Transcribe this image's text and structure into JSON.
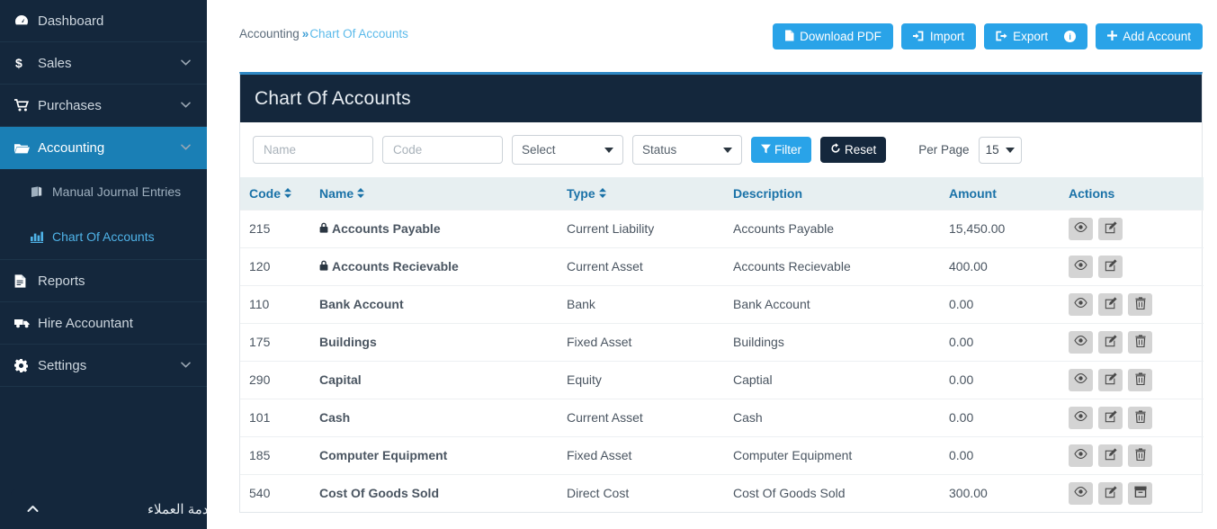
{
  "sidebar": {
    "items": [
      {
        "label": "Dashboard",
        "icon": "dashboard-icon",
        "glyph": "⚙",
        "caret": false,
        "active": false
      },
      {
        "label": "Sales",
        "icon": "dollar-icon",
        "glyph": "$",
        "caret": true,
        "active": false
      },
      {
        "label": "Purchases",
        "icon": "cart-icon",
        "glyph": "🛒",
        "caret": true,
        "active": false
      },
      {
        "label": "Accounting",
        "icon": "folder-open-icon",
        "glyph": "🗁",
        "caret": true,
        "active": true
      }
    ],
    "sub_items": [
      {
        "label": "Manual Journal Entries",
        "icon": "book-icon",
        "glyph": "📕",
        "selected": false
      },
      {
        "label": "Chart Of Accounts",
        "icon": "bar-chart-icon",
        "glyph": "📊",
        "selected": true
      }
    ],
    "items_after": [
      {
        "label": "Reports",
        "icon": "file-text-icon",
        "glyph": "📄",
        "caret": false,
        "active": false
      },
      {
        "label": "Hire Accountant",
        "icon": "truck-icon",
        "glyph": "🚚",
        "caret": false,
        "active": false
      },
      {
        "label": "Settings",
        "icon": "gear-icon",
        "glyph": "⚙",
        "caret": true,
        "active": false
      }
    ],
    "customer_service": {
      "label": "خدمة العملاء",
      "chevron": "⌃"
    }
  },
  "breadcrumb": {
    "root": "Accounting",
    "separator": "»",
    "current": "Chart Of Accounts"
  },
  "toolbar": {
    "download_pdf": "Download PDF",
    "import": "Import",
    "export": "Export",
    "add_account": "Add Account",
    "info_badge": "i"
  },
  "panel": {
    "title": "Chart Of Accounts"
  },
  "filters": {
    "name_placeholder": "Name",
    "name_value": "",
    "code_placeholder": "Code",
    "code_value": "",
    "type_select": "Select",
    "status_select": "Status",
    "filter_button": "Filter",
    "reset_button": "Reset",
    "per_page_label": "Per Page",
    "per_page_value": "15"
  },
  "table": {
    "columns": [
      {
        "label": "Code",
        "sortable": true
      },
      {
        "label": "Name",
        "sortable": true
      },
      {
        "label": "Type",
        "sortable": true
      },
      {
        "label": "Description",
        "sortable": false
      },
      {
        "label": "Amount",
        "sortable": false
      },
      {
        "label": "Actions",
        "sortable": false
      }
    ],
    "rows": [
      {
        "code": "215",
        "name": "Accounts Payable",
        "locked": true,
        "type": "Current Liability",
        "description": "Accounts Payable",
        "amount": "15,450.00",
        "actions": [
          "view",
          "edit"
        ]
      },
      {
        "code": "120",
        "name": "Accounts Recievable",
        "locked": true,
        "type": "Current Asset",
        "description": "Accounts Recievable",
        "amount": "400.00",
        "actions": [
          "view",
          "edit"
        ]
      },
      {
        "code": "110",
        "name": "Bank Account",
        "locked": false,
        "type": "Bank",
        "description": "Bank Account",
        "amount": "0.00",
        "actions": [
          "view",
          "edit",
          "delete"
        ]
      },
      {
        "code": "175",
        "name": "Buildings",
        "locked": false,
        "type": "Fixed Asset",
        "description": "Buildings",
        "amount": "0.00",
        "actions": [
          "view",
          "edit",
          "delete"
        ]
      },
      {
        "code": "290",
        "name": "Capital",
        "locked": false,
        "type": "Equity",
        "description": "Captial",
        "amount": "0.00",
        "actions": [
          "view",
          "edit",
          "delete"
        ]
      },
      {
        "code": "101",
        "name": "Cash",
        "locked": false,
        "type": "Current Asset",
        "description": "Cash",
        "amount": "0.00",
        "actions": [
          "view",
          "edit",
          "delete"
        ]
      },
      {
        "code": "185",
        "name": "Computer Equipment",
        "locked": false,
        "type": "Fixed Asset",
        "description": "Computer Equipment",
        "amount": "0.00",
        "actions": [
          "view",
          "edit",
          "delete"
        ]
      },
      {
        "code": "540",
        "name": "Cost Of Goods Sold",
        "locked": false,
        "type": "Direct Cost",
        "description": "Cost Of Goods Sold",
        "amount": "300.00",
        "actions": [
          "view",
          "edit",
          "archive"
        ]
      }
    ]
  },
  "colors": {
    "sidebar_bg": "#14273c",
    "accent_blue": "#1a7fb5",
    "button_blue": "#29a3e8",
    "table_header_bg": "#e7eff1",
    "table_header_text": "#1a72a8",
    "link_blue": "#5bbaea"
  }
}
